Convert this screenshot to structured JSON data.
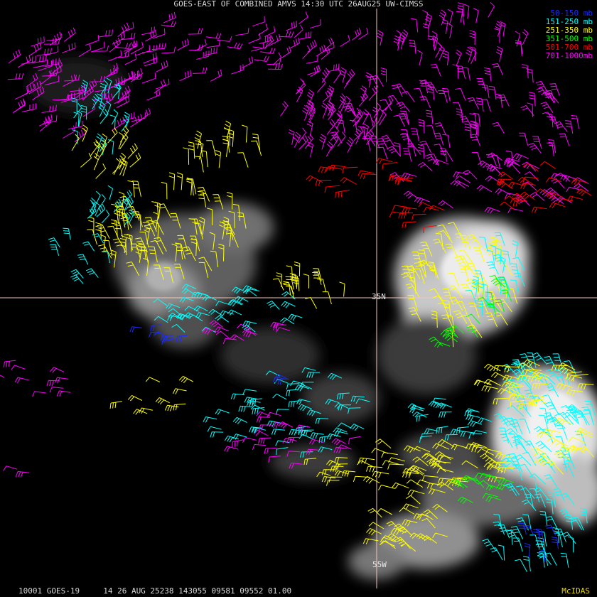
{
  "header": {
    "title": "GOES-EAST OF COMBINED AMVS 14:30 UTC 26AUG25 UW-CIMSS"
  },
  "legend": [
    {
      "label": "50-150 mb",
      "color": "#1a2cff"
    },
    {
      "label": "151-250 mb",
      "color": "#00ffff"
    },
    {
      "label": "251-350 mb",
      "color": "#ffff00"
    },
    {
      "label": "351-500 mb",
      "color": "#00ff00"
    },
    {
      "label": "501-700 mb",
      "color": "#ff0000"
    },
    {
      "label": "701-1000mb",
      "color": "#ff00ff"
    }
  ],
  "gridlines": {
    "lat_label": "35N",
    "lon_label": "55W",
    "color": "#f0c8b8"
  },
  "footer": {
    "info": "10001 GOES-19     14 26 AUG 25238 143055 09581 09552 01.00",
    "brand": "McIDAS"
  }
}
